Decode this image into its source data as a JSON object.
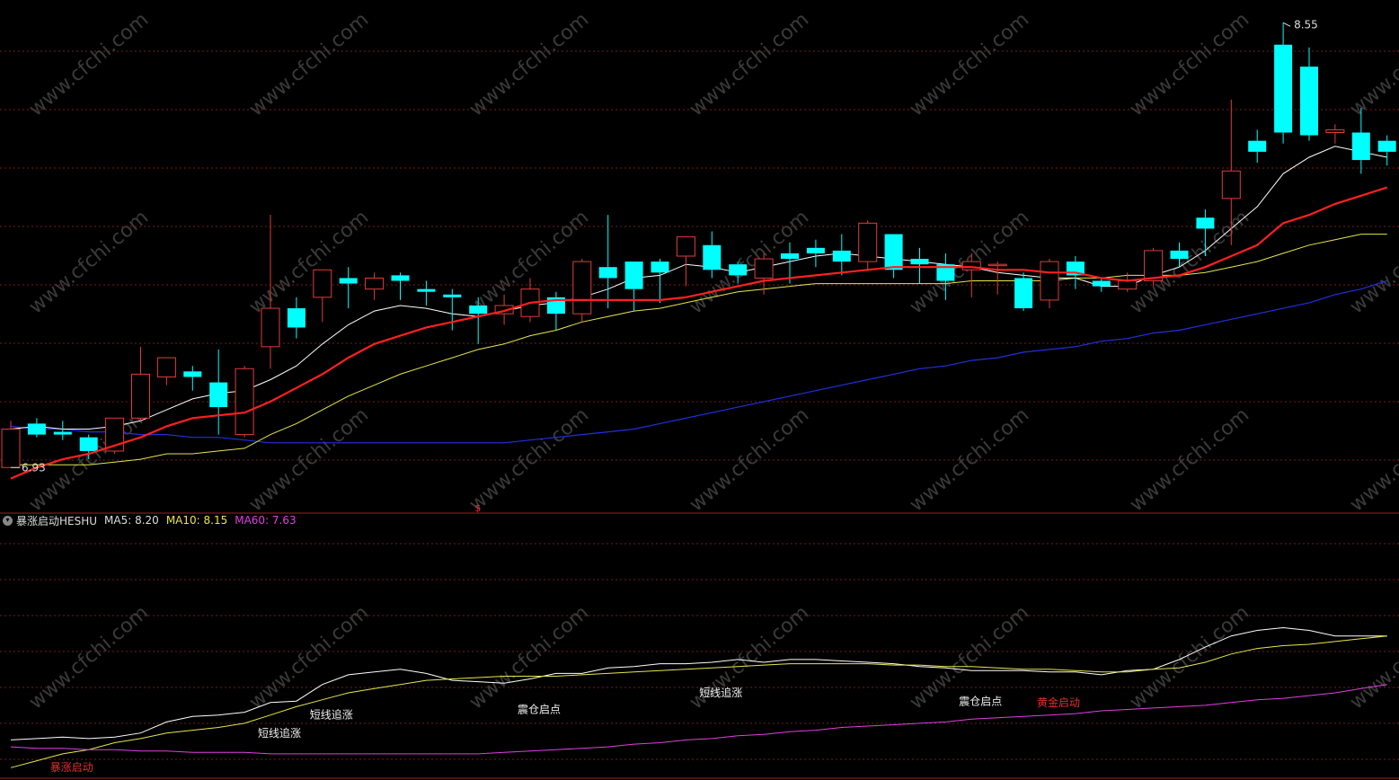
{
  "indicator": {
    "name": "暴涨启动HESHU",
    "ma5_text": "MA5: 8.20",
    "ma10_text": "MA10: 8.15",
    "ma60_text": "MA60: 7.63"
  },
  "colors": {
    "background": "#000000",
    "up_candle": "#e03c3c",
    "down_candle": "#00ffff",
    "ma_white": "#ffffff",
    "ma_red": "#ff2020",
    "ma_yellow": "#e6e64c",
    "ma_blue": "#2030e0",
    "ind_white": "#ffffff",
    "ind_yellow": "#e6e64c",
    "ind_magenta": "#e040e0",
    "grid": "#7a1a1a",
    "label_red": "#e03030",
    "label_white": "#eeeeee",
    "watermark": "#3a3a3a"
  },
  "watermark_text": "www.cfchi.com",
  "chart_data": [
    {
      "type": "candlestick",
      "panel": "price",
      "y_range": [
        6.8,
        8.6
      ],
      "high_label": "8.55",
      "low_label": "6.93",
      "marker_symbol": "$",
      "candles": [
        {
          "o": 6.93,
          "h": 7.1,
          "l": 6.93,
          "c": 7.07
        },
        {
          "o": 7.09,
          "h": 7.11,
          "l": 7.04,
          "c": 7.05
        },
        {
          "o": 7.06,
          "h": 7.1,
          "l": 7.03,
          "c": 7.05
        },
        {
          "o": 7.04,
          "h": 7.05,
          "l": 6.96,
          "c": 6.99
        },
        {
          "o": 6.99,
          "h": 7.11,
          "l": 6.98,
          "c": 7.11
        },
        {
          "o": 7.11,
          "h": 7.37,
          "l": 7.1,
          "c": 7.27
        },
        {
          "o": 7.26,
          "h": 7.33,
          "l": 7.23,
          "c": 7.33
        },
        {
          "o": 7.28,
          "h": 7.3,
          "l": 7.21,
          "c": 7.26
        },
        {
          "o": 7.24,
          "h": 7.36,
          "l": 7.05,
          "c": 7.15
        },
        {
          "o": 7.05,
          "h": 7.3,
          "l": 7.04,
          "c": 7.29
        },
        {
          "o": 7.37,
          "h": 7.85,
          "l": 7.29,
          "c": 7.51
        },
        {
          "o": 7.51,
          "h": 7.55,
          "l": 7.4,
          "c": 7.44
        },
        {
          "o": 7.55,
          "h": 7.62,
          "l": 7.46,
          "c": 7.65
        },
        {
          "o": 7.62,
          "h": 7.66,
          "l": 7.51,
          "c": 7.6
        },
        {
          "o": 7.58,
          "h": 7.64,
          "l": 7.54,
          "c": 7.62
        },
        {
          "o": 7.63,
          "h": 7.64,
          "l": 7.54,
          "c": 7.61
        },
        {
          "o": 7.58,
          "h": 7.61,
          "l": 7.52,
          "c": 7.57
        },
        {
          "o": 7.56,
          "h": 7.58,
          "l": 7.43,
          "c": 7.55
        },
        {
          "o": 7.52,
          "h": 7.55,
          "l": 7.38,
          "c": 7.49
        },
        {
          "o": 7.49,
          "h": 7.56,
          "l": 7.45,
          "c": 7.52
        },
        {
          "o": 7.48,
          "h": 7.62,
          "l": 7.46,
          "c": 7.58
        },
        {
          "o": 7.55,
          "h": 7.57,
          "l": 7.43,
          "c": 7.49
        },
        {
          "o": 7.49,
          "h": 7.69,
          "l": 7.46,
          "c": 7.68
        },
        {
          "o": 7.66,
          "h": 7.85,
          "l": 7.51,
          "c": 7.62
        },
        {
          "o": 7.68,
          "h": 7.68,
          "l": 7.5,
          "c": 7.58
        },
        {
          "o": 7.68,
          "h": 7.69,
          "l": 7.53,
          "c": 7.64
        },
        {
          "o": 7.7,
          "h": 7.75,
          "l": 7.59,
          "c": 7.77
        },
        {
          "o": 7.74,
          "h": 7.79,
          "l": 7.62,
          "c": 7.65
        },
        {
          "o": 7.67,
          "h": 7.68,
          "l": 7.6,
          "c": 7.63
        },
        {
          "o": 7.62,
          "h": 7.71,
          "l": 7.56,
          "c": 7.69
        },
        {
          "o": 7.71,
          "h": 7.75,
          "l": 7.6,
          "c": 7.69
        },
        {
          "o": 7.73,
          "h": 7.76,
          "l": 7.66,
          "c": 7.71
        },
        {
          "o": 7.72,
          "h": 7.78,
          "l": 7.63,
          "c": 7.68
        },
        {
          "o": 7.68,
          "h": 7.83,
          "l": 7.65,
          "c": 7.82
        },
        {
          "o": 7.78,
          "h": 7.78,
          "l": 7.62,
          "c": 7.65
        },
        {
          "o": 7.69,
          "h": 7.73,
          "l": 7.6,
          "c": 7.67
        },
        {
          "o": 7.67,
          "h": 7.71,
          "l": 7.54,
          "c": 7.61
        },
        {
          "o": 7.65,
          "h": 7.71,
          "l": 7.55,
          "c": 7.68
        },
        {
          "o": 7.67,
          "h": 7.68,
          "l": 7.56,
          "c": 7.67
        },
        {
          "o": 7.62,
          "h": 7.64,
          "l": 7.5,
          "c": 7.51
        },
        {
          "o": 7.54,
          "h": 7.69,
          "l": 7.51,
          "c": 7.68
        },
        {
          "o": 7.68,
          "h": 7.7,
          "l": 7.58,
          "c": 7.63
        },
        {
          "o": 7.61,
          "h": 7.62,
          "l": 7.57,
          "c": 7.59
        },
        {
          "o": 7.58,
          "h": 7.64,
          "l": 7.57,
          "c": 7.61
        },
        {
          "o": 7.61,
          "h": 7.73,
          "l": 7.59,
          "c": 7.72
        },
        {
          "o": 7.72,
          "h": 7.75,
          "l": 7.66,
          "c": 7.69
        },
        {
          "o": 7.84,
          "h": 7.87,
          "l": 7.7,
          "c": 7.8
        },
        {
          "o": 7.91,
          "h": 8.27,
          "l": 7.74,
          "c": 8.01
        },
        {
          "o": 8.12,
          "h": 8.16,
          "l": 8.04,
          "c": 8.08
        },
        {
          "o": 8.47,
          "h": 8.55,
          "l": 8.11,
          "c": 8.15
        },
        {
          "o": 8.39,
          "h": 8.46,
          "l": 8.12,
          "c": 8.14
        },
        {
          "o": 8.15,
          "h": 8.18,
          "l": 8.11,
          "c": 8.16
        },
        {
          "o": 8.15,
          "h": 8.24,
          "l": 8.0,
          "c": 8.05
        },
        {
          "o": 8.12,
          "h": 8.14,
          "l": 8.03,
          "c": 8.08
        }
      ],
      "ma_white": [
        7.07,
        7.08,
        7.07,
        7.07,
        7.08,
        7.1,
        7.14,
        7.18,
        7.2,
        7.21,
        7.25,
        7.3,
        7.38,
        7.45,
        7.5,
        7.52,
        7.51,
        7.49,
        7.48,
        7.5,
        7.52,
        7.53,
        7.55,
        7.58,
        7.62,
        7.63,
        7.67,
        7.66,
        7.64,
        7.66,
        7.68,
        7.7,
        7.71,
        7.7,
        7.69,
        7.68,
        7.67,
        7.66,
        7.64,
        7.63,
        7.62,
        7.62,
        7.59,
        7.59,
        7.63,
        7.66,
        7.72,
        7.8,
        7.88,
        8.0,
        8.06,
        8.1,
        8.08,
        8.06
      ],
      "ma_red": [
        6.89,
        6.93,
        6.96,
        6.98,
        7.01,
        7.04,
        7.08,
        7.11,
        7.12,
        7.13,
        7.17,
        7.22,
        7.27,
        7.33,
        7.38,
        7.41,
        7.44,
        7.46,
        7.48,
        7.5,
        7.53,
        7.54,
        7.54,
        7.54,
        7.54,
        7.54,
        7.55,
        7.57,
        7.59,
        7.61,
        7.62,
        7.63,
        7.64,
        7.65,
        7.66,
        7.66,
        7.66,
        7.66,
        7.65,
        7.65,
        7.64,
        7.64,
        7.62,
        7.61,
        7.62,
        7.63,
        7.66,
        7.7,
        7.74,
        7.82,
        7.85,
        7.89,
        7.92,
        7.95
      ],
      "ma_yellow": [
        6.94,
        6.94,
        6.94,
        6.94,
        6.95,
        6.96,
        6.98,
        6.98,
        6.99,
        7.0,
        7.05,
        7.09,
        7.14,
        7.19,
        7.23,
        7.27,
        7.3,
        7.33,
        7.36,
        7.38,
        7.41,
        7.43,
        7.46,
        7.48,
        7.5,
        7.51,
        7.53,
        7.55,
        7.57,
        7.58,
        7.59,
        7.6,
        7.6,
        7.6,
        7.6,
        7.6,
        7.6,
        7.61,
        7.61,
        7.61,
        7.61,
        7.62,
        7.62,
        7.63,
        7.63,
        7.63,
        7.64,
        7.66,
        7.68,
        7.71,
        7.74,
        7.76,
        7.78,
        7.78
      ],
      "ma_blue": [
        7.08,
        7.07,
        7.07,
        7.06,
        7.06,
        7.05,
        7.05,
        7.04,
        7.04,
        7.03,
        7.02,
        7.02,
        7.02,
        7.02,
        7.02,
        7.02,
        7.02,
        7.02,
        7.02,
        7.02,
        7.03,
        7.04,
        7.05,
        7.06,
        7.07,
        7.09,
        7.11,
        7.13,
        7.15,
        7.17,
        7.19,
        7.21,
        7.23,
        7.25,
        7.27,
        7.29,
        7.3,
        7.32,
        7.33,
        7.35,
        7.36,
        7.37,
        7.39,
        7.4,
        7.42,
        7.43,
        7.45,
        7.47,
        7.49,
        7.51,
        7.53,
        7.56,
        7.58,
        7.61
      ]
    },
    {
      "type": "line",
      "panel": "indicator",
      "y_range": [
        6.8,
        8.55
      ],
      "series": [
        {
          "name": "MA5",
          "values": [
            7.05,
            7.06,
            7.07,
            7.06,
            7.07,
            7.1,
            7.18,
            7.22,
            7.23,
            7.25,
            7.32,
            7.33,
            7.45,
            7.52,
            7.54,
            7.56,
            7.53,
            7.48,
            7.47,
            7.46,
            7.49,
            7.53,
            7.53,
            7.57,
            7.58,
            7.6,
            7.6,
            7.61,
            7.63,
            7.61,
            7.63,
            7.63,
            7.62,
            7.61,
            7.6,
            7.58,
            7.57,
            7.55,
            7.55,
            7.55,
            7.54,
            7.54,
            7.52,
            7.55,
            7.56,
            7.63,
            7.72,
            7.8,
            7.84,
            7.86,
            7.84,
            7.8,
            7.8,
            7.8
          ]
        },
        {
          "name": "MA10",
          "values": [
            6.85,
            6.9,
            6.95,
            6.98,
            7.03,
            7.06,
            7.1,
            7.12,
            7.14,
            7.17,
            7.23,
            7.29,
            7.34,
            7.39,
            7.42,
            7.45,
            7.48,
            7.49,
            7.5,
            7.51,
            7.51,
            7.51,
            7.52,
            7.53,
            7.54,
            7.55,
            7.56,
            7.57,
            7.58,
            7.59,
            7.6,
            7.6,
            7.6,
            7.6,
            7.59,
            7.59,
            7.58,
            7.58,
            7.57,
            7.56,
            7.56,
            7.55,
            7.54,
            7.54,
            7.56,
            7.57,
            7.61,
            7.67,
            7.71,
            7.73,
            7.74,
            7.76,
            7.78,
            7.8
          ]
        },
        {
          "name": "MA60",
          "values": [
            7.0,
            6.99,
            6.99,
            6.98,
            6.98,
            6.97,
            6.97,
            6.96,
            6.96,
            6.96,
            6.95,
            6.95,
            6.95,
            6.95,
            6.95,
            6.95,
            6.95,
            6.95,
            6.95,
            6.96,
            6.97,
            6.98,
            6.99,
            7.0,
            7.02,
            7.03,
            7.05,
            7.06,
            7.08,
            7.09,
            7.11,
            7.12,
            7.14,
            7.15,
            7.16,
            7.17,
            7.18,
            7.2,
            7.21,
            7.22,
            7.23,
            7.24,
            7.26,
            7.27,
            7.28,
            7.29,
            7.3,
            7.32,
            7.34,
            7.35,
            7.37,
            7.39,
            7.42,
            7.45
          ]
        }
      ],
      "annotations": [
        {
          "index": 2,
          "text": "暴涨启动",
          "color": "label_red"
        },
        {
          "index": 10,
          "text": "短线追涨",
          "color": "label_white"
        },
        {
          "index": 12,
          "text": "短线追涨",
          "color": "label_white"
        },
        {
          "index": 20,
          "text": "震仓启点",
          "color": "label_white"
        },
        {
          "index": 27,
          "text": "短线追涨",
          "color": "label_white"
        },
        {
          "index": 37,
          "text": "震仓启点",
          "color": "label_white"
        },
        {
          "index": 40,
          "text": "黄金启动",
          "color": "label_red"
        }
      ]
    }
  ]
}
